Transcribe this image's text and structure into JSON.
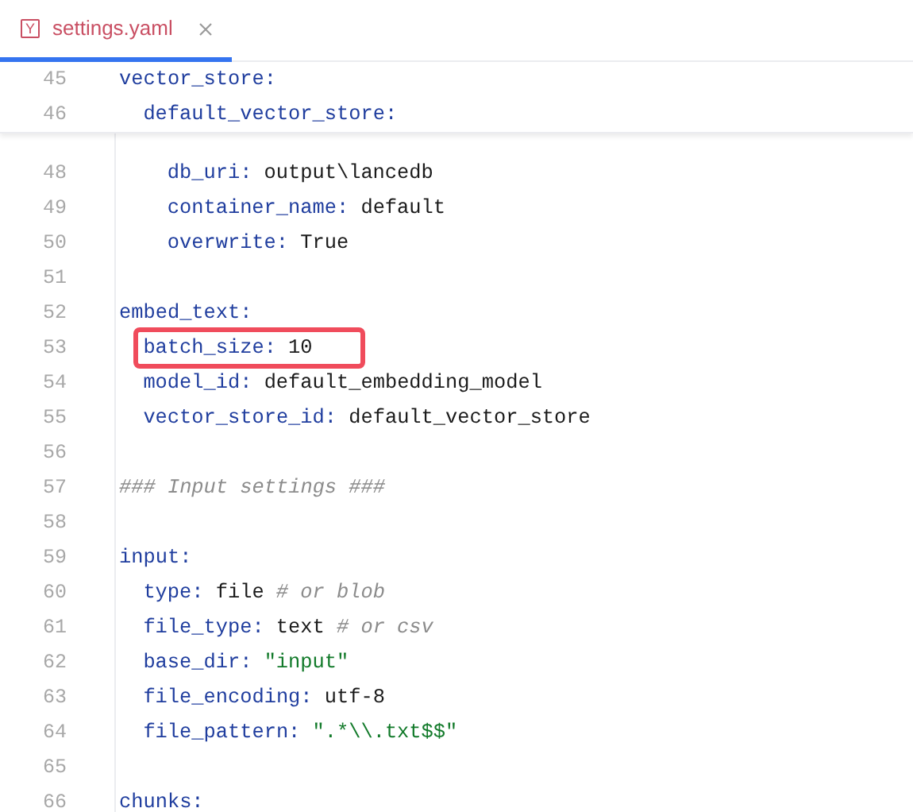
{
  "tabs": [
    {
      "label": "settings.yaml",
      "icon": "Y",
      "selected": true
    }
  ],
  "lines": [
    {
      "number": "45",
      "key": "vector_store:",
      "children": [
        {
          "number": "46",
          "key": "default_vector_store:",
          "children": [
            {
              "number": "48",
              "kind": "plain",
              "key": "db_uri:",
              "value": "output\\lancedb"
            },
            {
              "number": "49",
              "kind": "plain",
              "key": "container_name:",
              "value": "default"
            },
            {
              "number": "50",
              "kind": "plain",
              "key": "overwrite:",
              "value": "True"
            }
          ]
        }
      ]
    },
    {
      "number": "51"
    },
    {
      "number": "52",
      "key": "embed_text:",
      "children": [
        {
          "number": "53",
          "kind": "plain",
          "key": "batch_size:",
          "value": "10",
          "highlighted": true
        },
        {
          "number": "54",
          "kind": "plain",
          "key": "model_id:",
          "value": "default_embedding_model"
        },
        {
          "number": "55",
          "kind": "plain",
          "key": "vector_store_id:",
          "value": "default_vector_store"
        }
      ]
    },
    {
      "number": "56"
    },
    {
      "number": "57",
      "comment": "### Input settings ###"
    },
    {
      "number": "58"
    },
    {
      "number": "59",
      "key": "input:",
      "children": [
        {
          "number": "60",
          "kind": "plain",
          "key": "type:",
          "value": "file",
          "comment": "# or blob"
        },
        {
          "number": "61",
          "kind": "plain",
          "key": "file_type:",
          "value": "text",
          "comment": "# or csv"
        },
        {
          "number": "62",
          "kind": "string",
          "key": "base_dir:",
          "value": "\"input\""
        },
        {
          "number": "63",
          "kind": "plain",
          "key": "file_encoding:",
          "value": "utf-8"
        },
        {
          "number": "64",
          "kind": "string",
          "key": "file_pattern:",
          "value": "\".*\\\\.txt$$\""
        }
      ]
    },
    {
      "number": "65"
    },
    {
      "number": "66",
      "key": "chunks:"
    }
  ]
}
